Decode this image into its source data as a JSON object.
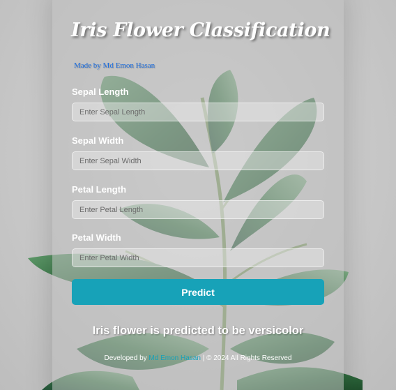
{
  "page": {
    "title": "Iris Flower Classification",
    "byline": "Made by Md Emon Hasan"
  },
  "form": {
    "fields": [
      {
        "label": "Sepal Length",
        "placeholder": "Enter Sepal Length",
        "value": ""
      },
      {
        "label": "Sepal Width",
        "placeholder": "Enter Sepal Width",
        "value": ""
      },
      {
        "label": "Petal Length",
        "placeholder": "Enter Petal Length",
        "value": ""
      },
      {
        "label": "Petal Width",
        "placeholder": "Enter Petal Width",
        "value": ""
      }
    ],
    "submit_label": "Predict"
  },
  "result": {
    "text": "Iris flower is predicted to be versicolor"
  },
  "footer": {
    "prefix": "Developed by",
    "author": "Md Emon Hasan",
    "suffix": "| © 2024 All Rights Reserved"
  },
  "colors": {
    "accent": "#17a2b8",
    "byline": "#1e6fe0",
    "leaf": "#2f6b3e",
    "background": "#c9c9c9"
  },
  "icons": {
    "background": "plant-leaves"
  }
}
